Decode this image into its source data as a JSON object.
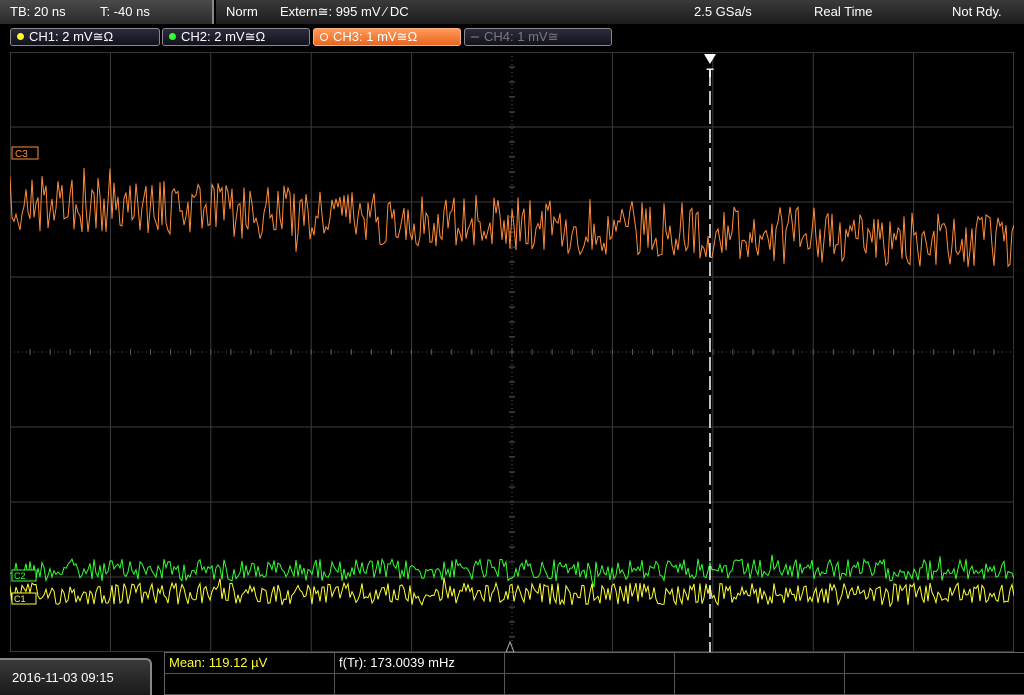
{
  "header": {
    "timebase": "TB: 20 ns",
    "trigger_offset": "T: -40 ns",
    "trigger_mode": "Norm",
    "trigger_source": "Extern≅: 995 mV ⁄ DC",
    "sample_rate": "2.5 GSa/s",
    "acq_mode": "Real Time",
    "status": "Not Rdy."
  },
  "channels": [
    {
      "label": "CH1: 2 mV≅Ω",
      "color": "#ffff33"
    },
    {
      "label": "CH2: 2 mV≅Ω",
      "color": "#33ff33"
    },
    {
      "label": "CH3: 1 mV≅Ω",
      "color": "#ff8c3c"
    },
    {
      "label": "CH4: 1 mV≅",
      "color": "#7a7a7a"
    }
  ],
  "screen": {
    "trigger_marker": "T",
    "ch3_marker": "C3",
    "ch2_marker": "C2",
    "ch1_marker": "C1"
  },
  "footer": {
    "datetime": "2016-11-03 09:15",
    "mean": "Mean: 119.12 µV",
    "freq": "f(Tr): 173.0039 mHz"
  }
}
